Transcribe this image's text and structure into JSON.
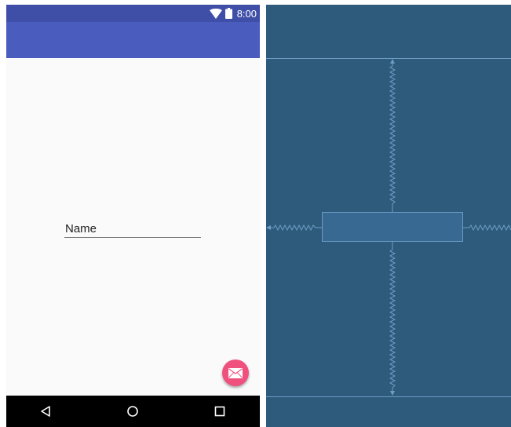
{
  "status_bar": {
    "time": "8:00",
    "icons": [
      "wifi-icon",
      "battery-icon"
    ]
  },
  "form": {
    "name_field": {
      "value": "Name"
    }
  },
  "fab": {
    "icon": "email-icon",
    "color": "#f0507e"
  },
  "navigation": {
    "buttons": [
      "back-icon",
      "home-icon",
      "recents-icon"
    ]
  },
  "colors": {
    "status_bar": "#3f4fa8",
    "app_bar": "#4a5dbf",
    "blueprint_background": "#2e5b7b",
    "blueprint_lines": "#6d9cc5"
  }
}
